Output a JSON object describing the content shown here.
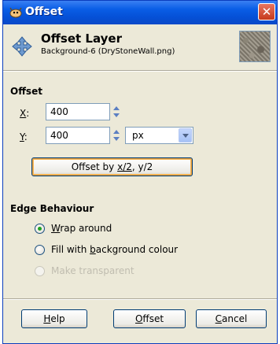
{
  "window": {
    "title": "Offset",
    "close_glyph": "✕"
  },
  "header": {
    "title": "Offset Layer",
    "subtitle": "Background-6 (DryStoneWall.png)",
    "icon": "move-icon",
    "thumbnail": "layer-thumbnail"
  },
  "offset": {
    "section_title": "Offset",
    "x_label_key": "X",
    "x_label_rest": ":",
    "x_value": "400",
    "y_label_key": "Y",
    "y_label_rest": ":",
    "y_value": "400",
    "unit": "px",
    "offset_half_label_pre": "Offset by ",
    "offset_half_label_key": "x/2",
    "offset_half_label_post": ", y/2"
  },
  "edge": {
    "section_title": "Edge Behaviour",
    "wrap_key": "W",
    "wrap_rest": "rap around",
    "fill_pre": "Fill with ",
    "fill_key": "b",
    "fill_post": "ackground colour",
    "transparent_label": "Make transparent",
    "selected": "wrap"
  },
  "buttons": {
    "help_key": "H",
    "help_rest": "elp",
    "offset_key": "O",
    "offset_rest": "ffset",
    "cancel_key": "C",
    "cancel_rest": "ancel"
  }
}
